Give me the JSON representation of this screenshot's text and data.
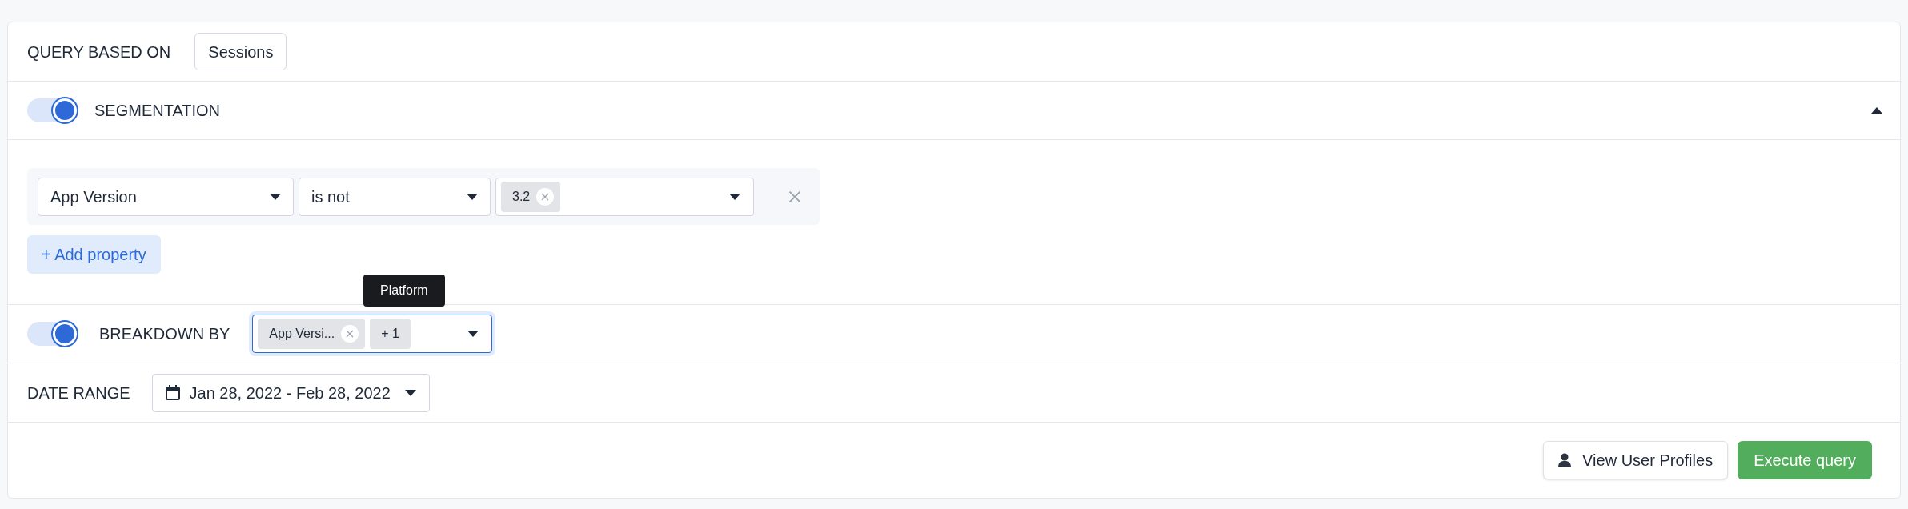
{
  "query_based_on": {
    "label": "QUERY BASED ON",
    "value": "Sessions"
  },
  "segmentation": {
    "label": "SEGMENTATION",
    "on": true,
    "expanded": true,
    "filters": [
      {
        "property": "App Version",
        "operator": "is not",
        "values": [
          "3.2"
        ]
      }
    ],
    "add_button": "+ Add property"
  },
  "breakdown": {
    "label": "BREAKDOWN BY",
    "on": true,
    "focused": true,
    "chips": [
      {
        "text": "App Versi...",
        "removable": true
      },
      {
        "text": "+ 1",
        "removable": false
      }
    ],
    "tooltip": "Platform"
  },
  "date_range": {
    "label": "DATE RANGE",
    "value": "Jan 28, 2022 - Feb 28, 2022"
  },
  "actions": [
    {
      "kind": "secondary",
      "label": "View User Profiles"
    },
    {
      "kind": "primary",
      "label": "Execute query"
    }
  ]
}
